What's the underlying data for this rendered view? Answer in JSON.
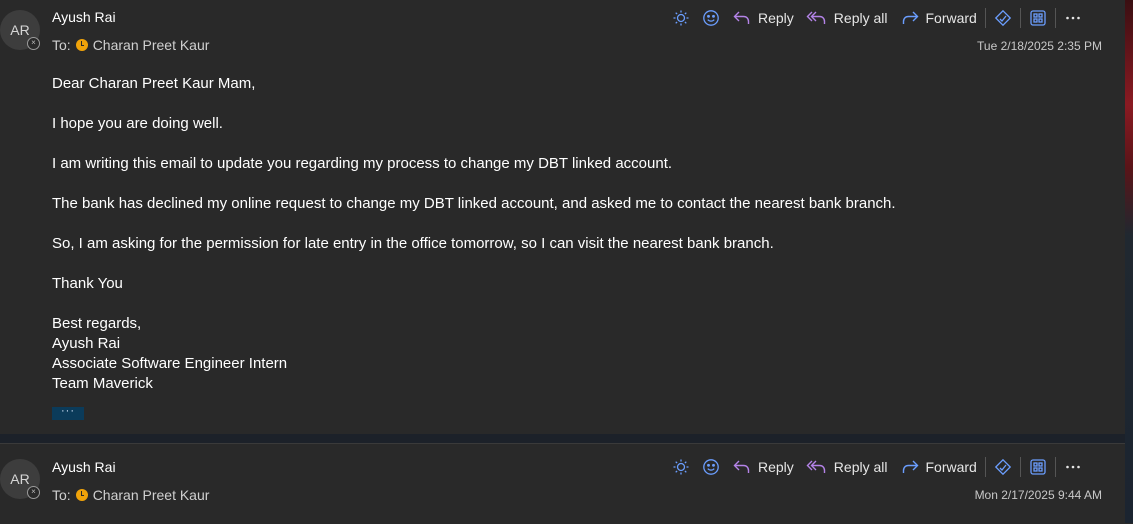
{
  "messages": [
    {
      "avatar_initials": "AR",
      "sender": "Ayush Rai",
      "to_label": "To:",
      "recipient": "Charan Preet Kaur",
      "timestamp": "Tue 2/18/2025 2:35 PM",
      "toolbar": {
        "reply": "Reply",
        "reply_all": "Reply all",
        "forward": "Forward"
      },
      "body": {
        "greeting": "Dear Charan Preet Kaur Mam,",
        "p1": "I hope you are doing well.",
        "p2": "I am writing this email to update you regarding my process to change my DBT linked account.",
        "p3": "The bank has declined my online request to change my DBT linked account, and  asked me to contact the nearest bank branch.",
        "p4": "So, I am asking for the permission for late entry in the office tomorrow, so I can visit the nearest bank branch.",
        "p5": "Thank You",
        "signature": [
          "Best regards,",
          "Ayush Rai",
          "Associate Software Engineer Intern",
          "Team Maverick"
        ]
      },
      "more_label": "···"
    },
    {
      "avatar_initials": "AR",
      "sender": "Ayush Rai",
      "to_label": "To:",
      "recipient": "Charan Preet Kaur",
      "timestamp": "Mon 2/17/2025 9:44 AM",
      "toolbar": {
        "reply": "Reply",
        "reply_all": "Reply all",
        "forward": "Forward"
      }
    }
  ],
  "icons": {
    "accent": "#6b9eff",
    "toolbar_icons": [
      "sun-icon",
      "emoji-icon",
      "reply-icon",
      "reply-all-icon",
      "forward-icon",
      "sticker-icon",
      "apps-icon",
      "more-icon"
    ]
  }
}
